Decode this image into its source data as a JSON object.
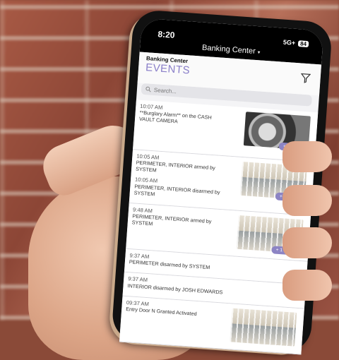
{
  "status": {
    "time": "8:20",
    "network": "5G+",
    "battery": "84"
  },
  "nav": {
    "title": "Banking Center",
    "caret": "▾"
  },
  "header": {
    "site": "Banking Center",
    "title": "EVENTS"
  },
  "search": {
    "placeholder": "Search..."
  },
  "events": [
    {
      "time": "10:07 AM",
      "text": "**Burglary Alarm** on the CASH VAULT CAMERA",
      "more": "+ 3 More"
    },
    {
      "time": "10:05 AM",
      "text": "PERIMETER, INTERIOR armed by SYSTEM",
      "more": "+ 1 More"
    },
    {
      "time": "10:05 AM",
      "text": "PERIMETER, INTERIOR disarmed by SYSTEM"
    },
    {
      "time": "9:48 AM",
      "text": "PERIMETER, INTERIOR armed by SYSTEM",
      "more": "+ 1 More"
    },
    {
      "time": "9:37 AM",
      "text": "PERIMETER disarmed by SYSTEM"
    },
    {
      "time": "9:37 AM",
      "text": "INTERIOR disarmed by JOSH EDWARDS"
    },
    {
      "time": "09:37 AM",
      "text": "Entry Door N Granted Activated"
    }
  ],
  "colors": {
    "accent": "#8a7fc9",
    "badge": "#8c84c4"
  }
}
